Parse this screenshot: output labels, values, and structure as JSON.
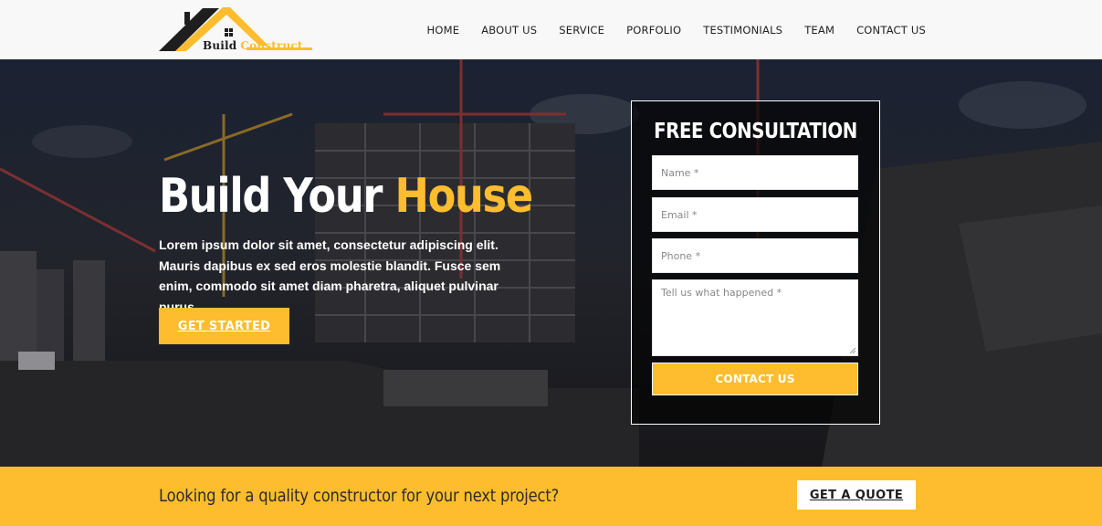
{
  "brand": {
    "logo_word1": "Build",
    "logo_word2": "Construct",
    "logo_icon": "house-roof-icon",
    "accent_color": "#fdbd2e",
    "dark_color": "#1e1e1e"
  },
  "nav": {
    "items": [
      {
        "label": "HOME"
      },
      {
        "label": "ABOUT US"
      },
      {
        "label": "SERVICE"
      },
      {
        "label": "PORFOLIO"
      },
      {
        "label": "TESTIMONIALS"
      },
      {
        "label": "TEAM"
      },
      {
        "label": "CONTACT US"
      }
    ]
  },
  "hero": {
    "title_plain": "Build Your",
    "title_accent": "House",
    "description": "Lorem ipsum dolor sit amet, consectetur adipiscing elit. Mauris dapibus ex sed eros molestie blandit. Fusce sem enim, commodo sit amet diam pharetra, aliquet pulvinar purus.",
    "cta_label": "GET STARTED"
  },
  "form": {
    "title": "FREE CONSULTATION",
    "name_placeholder": "Name *",
    "email_placeholder": "Email *",
    "phone_placeholder": "Phone *",
    "message_placeholder": "Tell us what happened *",
    "submit_label": "CONTACT US"
  },
  "cta_bar": {
    "text": "Looking for a quality constructor for your next project?",
    "button_label": "GET A QUOTE"
  }
}
